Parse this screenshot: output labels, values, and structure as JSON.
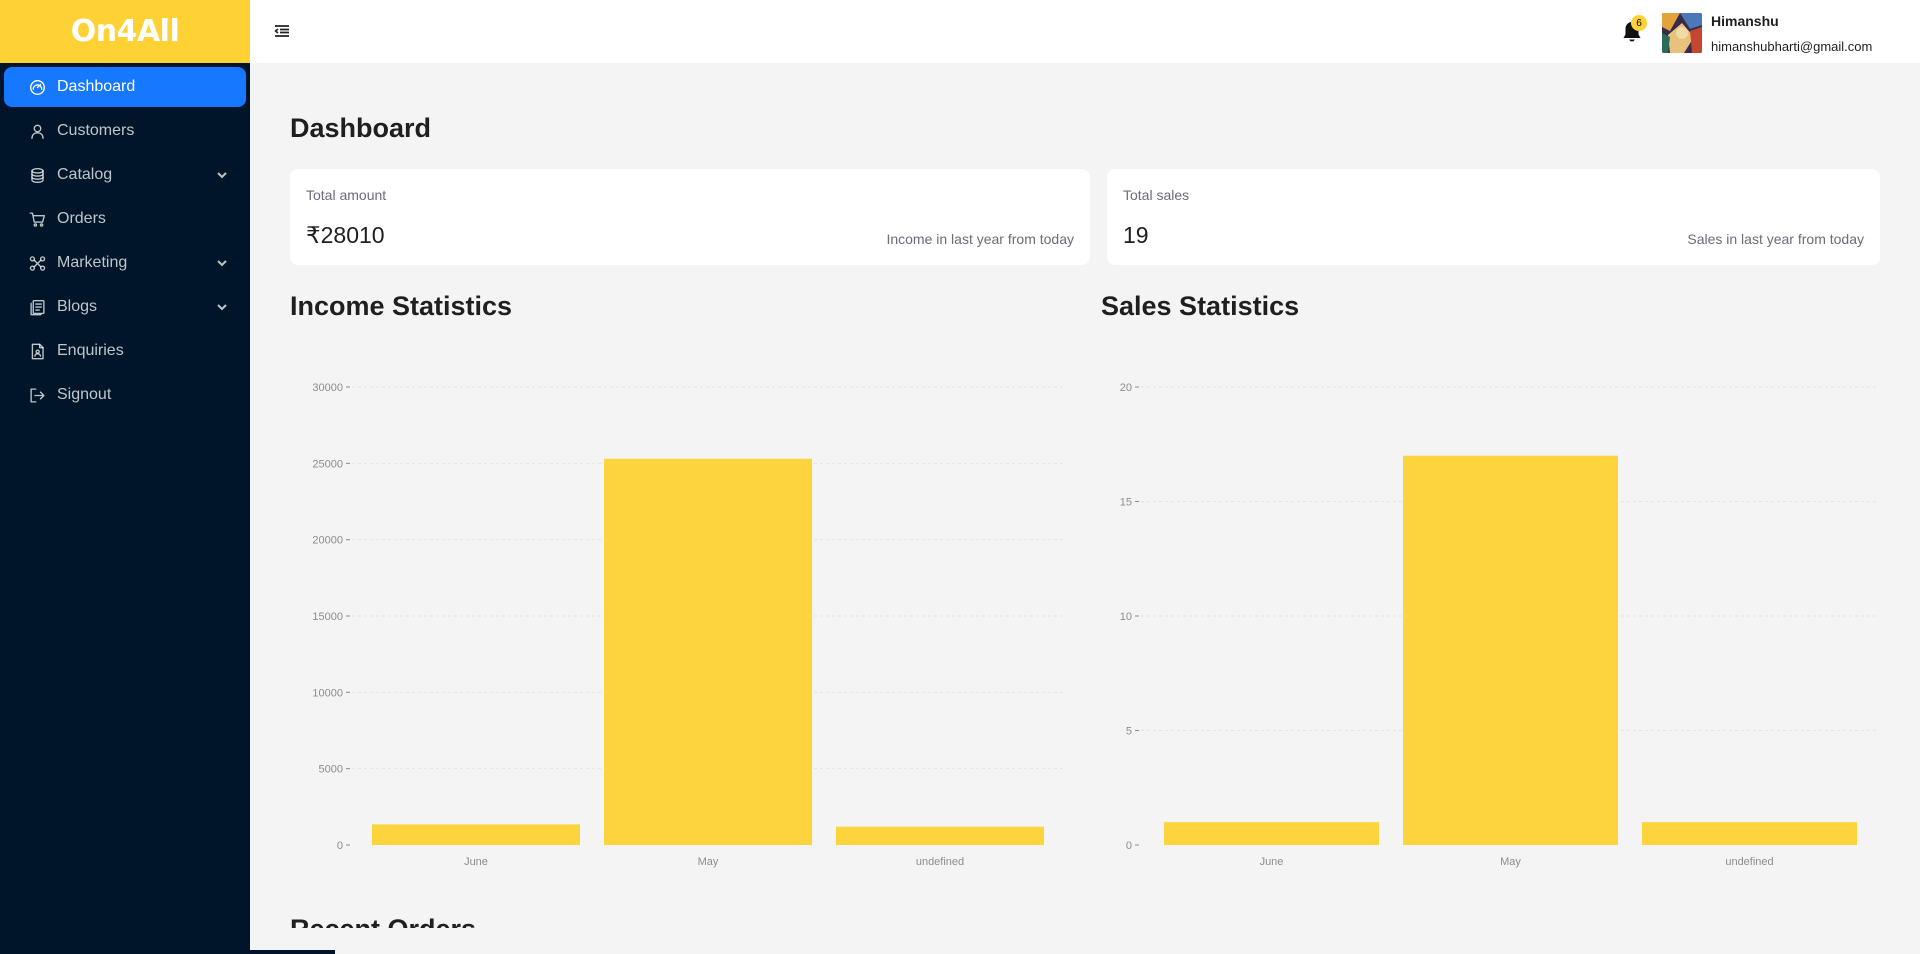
{
  "app": {
    "logo": "On4All"
  },
  "sidebar": {
    "items": [
      {
        "label": "Dashboard",
        "icon": "dashboard-icon",
        "active": true,
        "expandable": false
      },
      {
        "label": "Customers",
        "icon": "user-icon",
        "active": false,
        "expandable": false
      },
      {
        "label": "Catalog",
        "icon": "database-icon",
        "active": false,
        "expandable": true
      },
      {
        "label": "Orders",
        "icon": "cart-icon",
        "active": false,
        "expandable": false
      },
      {
        "label": "Marketing",
        "icon": "marketing-icon",
        "active": false,
        "expandable": true
      },
      {
        "label": "Blogs",
        "icon": "blog-icon",
        "active": false,
        "expandable": true
      },
      {
        "label": "Enquiries",
        "icon": "enquiry-icon",
        "active": false,
        "expandable": false
      },
      {
        "label": "Signout",
        "icon": "signout-icon",
        "active": false,
        "expandable": false
      }
    ]
  },
  "header": {
    "notification_count": "6",
    "user_name": "Himanshu",
    "user_email": "himanshubharti@gmail.com"
  },
  "main": {
    "title": "Dashboard",
    "cards": [
      {
        "label": "Total amount",
        "value": "₹28010",
        "sub": "Income in last year from today"
      },
      {
        "label": "Total sales",
        "value": "19",
        "sub": "Sales in last year from today"
      }
    ],
    "income_title": "Income Statistics",
    "sales_title": "Sales Statistics",
    "recent_title": "Recent Orders"
  },
  "colors": {
    "brand": "#fed235",
    "sidebar": "#001529",
    "active": "#1677ff",
    "bar": "#fed43e"
  },
  "chart_data": [
    {
      "type": "bar",
      "title": "Income Statistics",
      "categories": [
        "June",
        "May",
        "undefined"
      ],
      "values": [
        1350,
        25300,
        1200
      ],
      "ylim": [
        0,
        30000
      ],
      "yticks": [
        0,
        5000,
        10000,
        15000,
        20000,
        25000,
        30000
      ],
      "grid": true
    },
    {
      "type": "bar",
      "title": "Sales Statistics",
      "categories": [
        "June",
        "May",
        "undefined"
      ],
      "values": [
        1,
        17,
        1
      ],
      "ylim": [
        0,
        20
      ],
      "yticks": [
        0,
        5,
        10,
        15,
        20
      ],
      "grid": true
    }
  ]
}
